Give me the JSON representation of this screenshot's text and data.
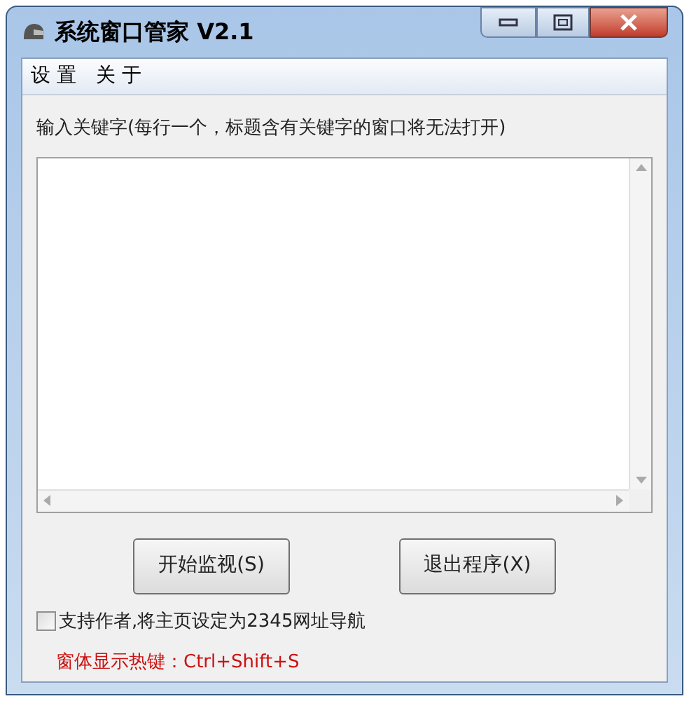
{
  "window": {
    "title": "系统窗口管家 V2.1"
  },
  "menu": [
    {
      "label": "设 置"
    },
    {
      "label": "关 于"
    }
  ],
  "instruction": "输入关键字(每行一个，标题含有关键字的窗口将无法打开)",
  "buttons": [
    {
      "label": "开始监视(S)"
    },
    {
      "label": "退出程序(X)"
    }
  ],
  "support_checkbox": {
    "label": "支持作者,将主页设定为2345网址导航",
    "checked": false
  },
  "hotkey_note": "窗体显示热键：Ctrl+Shift+S"
}
